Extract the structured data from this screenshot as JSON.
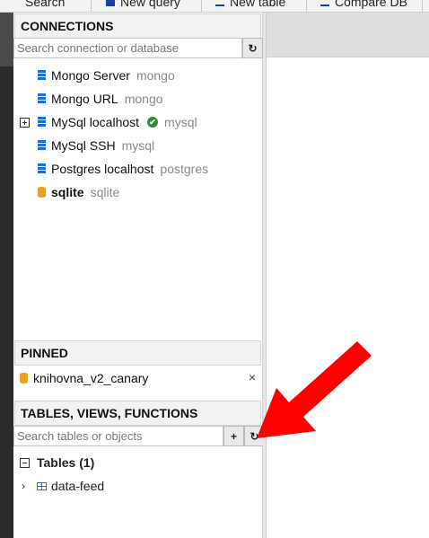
{
  "toolbar": {
    "buttons": [
      {
        "label": "Search",
        "icon": "list-icon"
      },
      {
        "label": "New query",
        "icon": "file-icon"
      },
      {
        "label": "New table",
        "icon": "table-icon"
      },
      {
        "label": "Compare DB",
        "icon": "compare-icon"
      }
    ]
  },
  "connections": {
    "title": "CONNECTIONS",
    "search_placeholder": "Search connection or database",
    "refresh_glyph": "↻",
    "items": [
      {
        "name": "Mongo Server",
        "type": "mongo"
      },
      {
        "name": "Mongo URL",
        "type": "mongo"
      },
      {
        "name": "MySql localhost",
        "type": "mysql",
        "status_glyph": "✔"
      },
      {
        "name": "MySql SSH",
        "type": "mysql"
      },
      {
        "name": "Postgres localhost",
        "type": "postgres"
      },
      {
        "name": "sqlite",
        "type": "sqlite"
      }
    ]
  },
  "pinned": {
    "title": "PINNED",
    "items": [
      {
        "name": "knihovna_v2_canary",
        "close_glyph": "×"
      }
    ]
  },
  "objects": {
    "title": "TABLES, VIEWS, FUNCTIONS",
    "search_placeholder": "Search tables or objects",
    "add_glyph": "+",
    "refresh_glyph": "↻",
    "group_label": "Tables (1)",
    "tables": [
      {
        "name": "data-feed",
        "chevron": "›"
      }
    ]
  },
  "colors": {
    "accent_blue": "#1c6ed0",
    "sqlite_orange": "#e6a12a",
    "ok_green": "#2e8b2e",
    "arrow_red": "#ff0000"
  }
}
